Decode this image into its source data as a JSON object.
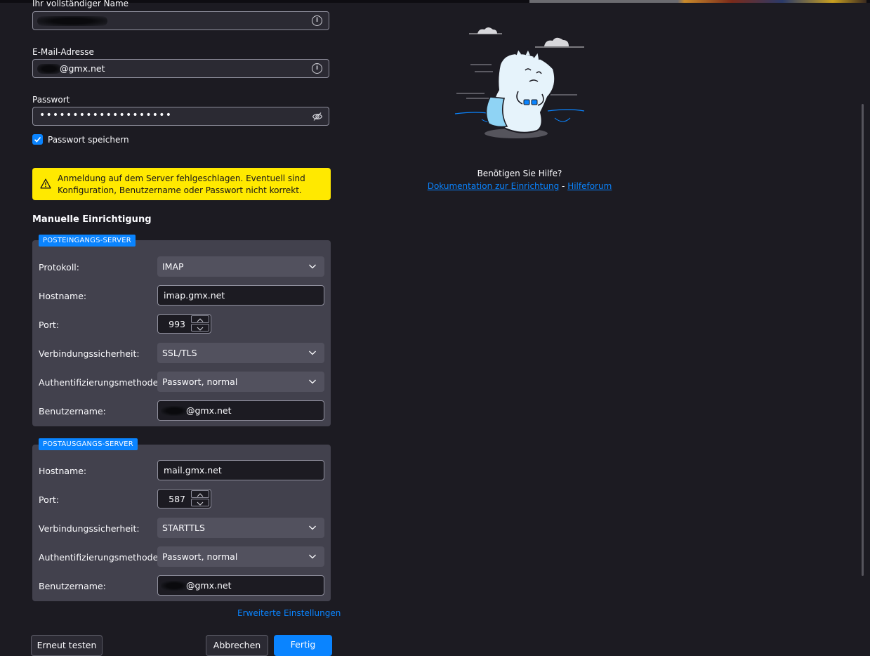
{
  "form": {
    "name_label": "Ihr vollständiger Name",
    "email_label": "E-Mail-Adresse",
    "email_value": "@gmx.net",
    "password_label": "Passwort",
    "password_value": "••••••••••••••••••••",
    "remember_label": "Passwort speichern",
    "remember_checked": true
  },
  "warning": {
    "line1": "Anmeldung auf dem Server fehlgeschlagen. Eventuell sind",
    "line2": "Konfiguration, Benutzername oder Passwort nicht korrekt."
  },
  "manual": {
    "title": "Manuelle Einrichtigung",
    "incoming": {
      "badge": "POSTEINGANGS-SERVER",
      "protocol_label": "Protokoll:",
      "protocol_value": "IMAP",
      "hostname_label": "Hostname:",
      "hostname_value": "imap.gmx.net",
      "port_label": "Port:",
      "port_value": "993",
      "security_label": "Verbindungssicherheit:",
      "security_value": "SSL/TLS",
      "auth_label": "Authentifizierungsmethode:",
      "auth_value": "Passwort, normal",
      "username_label": "Benutzername:",
      "username_value": "@gmx.net"
    },
    "outgoing": {
      "badge": "POSTAUSGANGS-SERVER",
      "hostname_label": "Hostname:",
      "hostname_value": "mail.gmx.net",
      "port_label": "Port:",
      "port_value": "587",
      "security_label": "Verbindungssicherheit:",
      "security_value": "STARTTLS",
      "auth_label": "Authentifizierungsmethode:",
      "auth_value": "Passwort, normal",
      "username_label": "Benutzername:",
      "username_value": "@gmx.net"
    },
    "advanced_link": "Erweiterte Einstellungen"
  },
  "buttons": {
    "retest": "Erneut testen",
    "cancel": "Abbrechen",
    "done": "Fertig"
  },
  "help": {
    "question": "Benötigen Sie Hilfe?",
    "docs_link": "Dokumentation zur Einrichtung",
    "separator": "-",
    "forum_link": "Hilfeforum"
  },
  "colors": {
    "background": "#1c1b22",
    "accent": "#0a84ff",
    "warning": "#ffe900",
    "panel": "#42414d"
  }
}
